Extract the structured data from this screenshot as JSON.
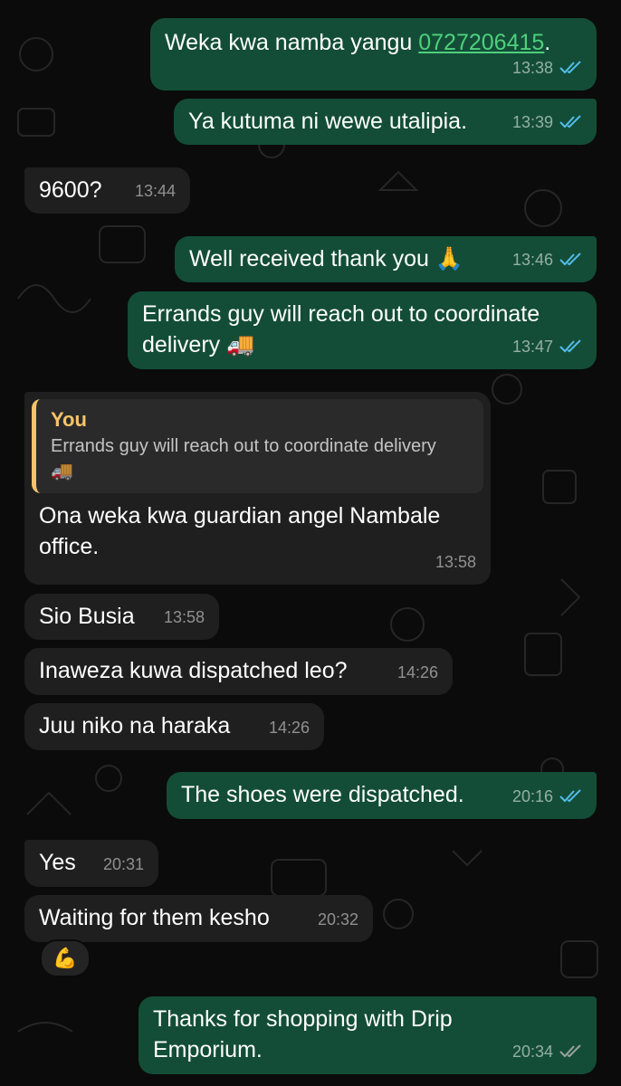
{
  "messages": {
    "m1": {
      "pre": "Weka kwa namba yangu ",
      "phone": "0727206415",
      "post": ".",
      "time": "13:38"
    },
    "m2": {
      "text": "Ya kutuma ni wewe utalipia.",
      "time": "13:39"
    },
    "m3": {
      "text": "9600?",
      "time": "13:44"
    },
    "m4": {
      "text": "Well received thank you 🙏",
      "time": "13:46"
    },
    "m5": {
      "line1": "Errands guy will reach out to coordinate",
      "line2": "delivery 🚚",
      "time": "13:47"
    },
    "m6": {
      "quote_author": "You",
      "quote_line1": "Errands guy will reach out to coordinate delivery",
      "quote_line2": "🚚",
      "line1": "Ona weka kwa guardian angel Nambale",
      "line2": "office.",
      "time": "13:58"
    },
    "m7": {
      "text": "Sio Busia",
      "time": "13:58"
    },
    "m8": {
      "text": "Inaweza kuwa dispatched leo?",
      "time": "14:26"
    },
    "m9": {
      "text": "Juu niko na haraka",
      "time": "14:26"
    },
    "m10": {
      "text": "The shoes were dispatched.",
      "time": "20:16"
    },
    "m11": {
      "text": "Yes",
      "time": "20:31"
    },
    "m12": {
      "text": "Waiting for them kesho",
      "time": "20:32",
      "reaction": "💪"
    },
    "m13": {
      "line1": "Thanks for shopping with Drip",
      "line2": "Emporium.",
      "time": "20:34"
    }
  },
  "colors": {
    "outgoing_bubble": "#134d37",
    "incoming_bubble": "#1f1f1f",
    "read_ticks": "#53bdeb",
    "delivered_ticks": "#9aa3a0",
    "quote_accent": "#f5c36b",
    "link": "#4fd07c"
  },
  "icons": {
    "read": "double-check-blue",
    "delivered": "double-check-gray"
  }
}
